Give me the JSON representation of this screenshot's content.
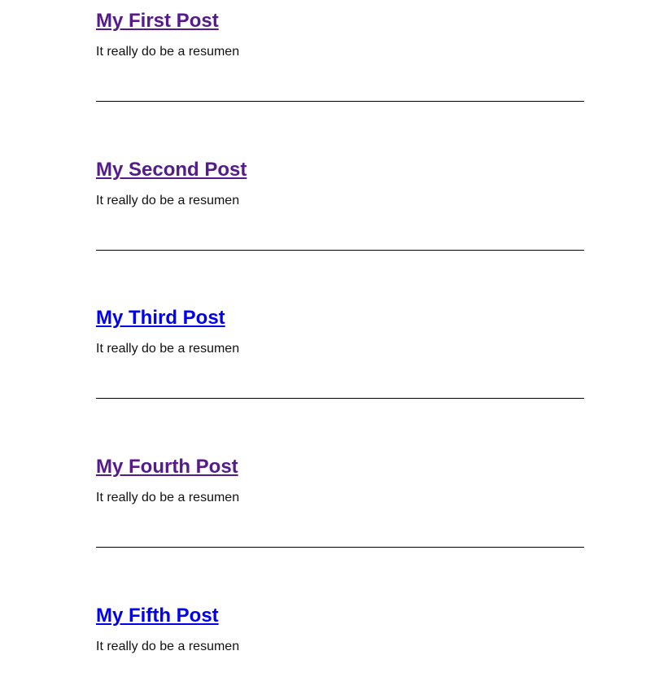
{
  "posts": [
    {
      "title": "My First Post",
      "summary": "It really do be a resumen",
      "visited": true
    },
    {
      "title": "My Second Post",
      "summary": "It really do be a resumen",
      "visited": true
    },
    {
      "title": "My Third Post",
      "summary": "It really do be a resumen",
      "visited": false
    },
    {
      "title": "My Fourth Post",
      "summary": "It really do be a resumen",
      "visited": true
    },
    {
      "title": "My Fifth Post",
      "summary": "It really do be a resumen",
      "visited": false
    }
  ],
  "colors": {
    "link": "#0000ee",
    "visited_link": "#551a8b",
    "text": "#111111",
    "divider": "#000000"
  }
}
